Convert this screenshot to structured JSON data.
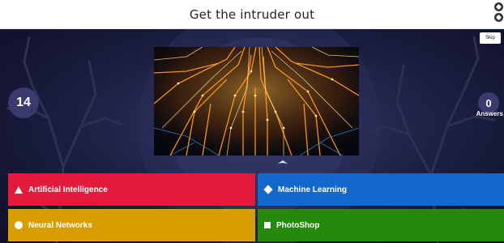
{
  "header": {
    "title": "Get the intruder out"
  },
  "controls": {
    "skip_label": "Skip"
  },
  "status": {
    "timer": "14",
    "answers_count": "0",
    "answers_label": "Answers"
  },
  "answers": [
    {
      "label": "Artificial Intelligence",
      "shape": "triangle-icon",
      "color": "#e21b3c"
    },
    {
      "label": "Machine Learning",
      "shape": "diamond-icon",
      "color": "#1368ce"
    },
    {
      "label": "Neural Networks",
      "shape": "circle-icon",
      "color": "#d89e00"
    },
    {
      "label": "PhotoShop",
      "shape": "square-icon",
      "color": "#26890c"
    }
  ]
}
